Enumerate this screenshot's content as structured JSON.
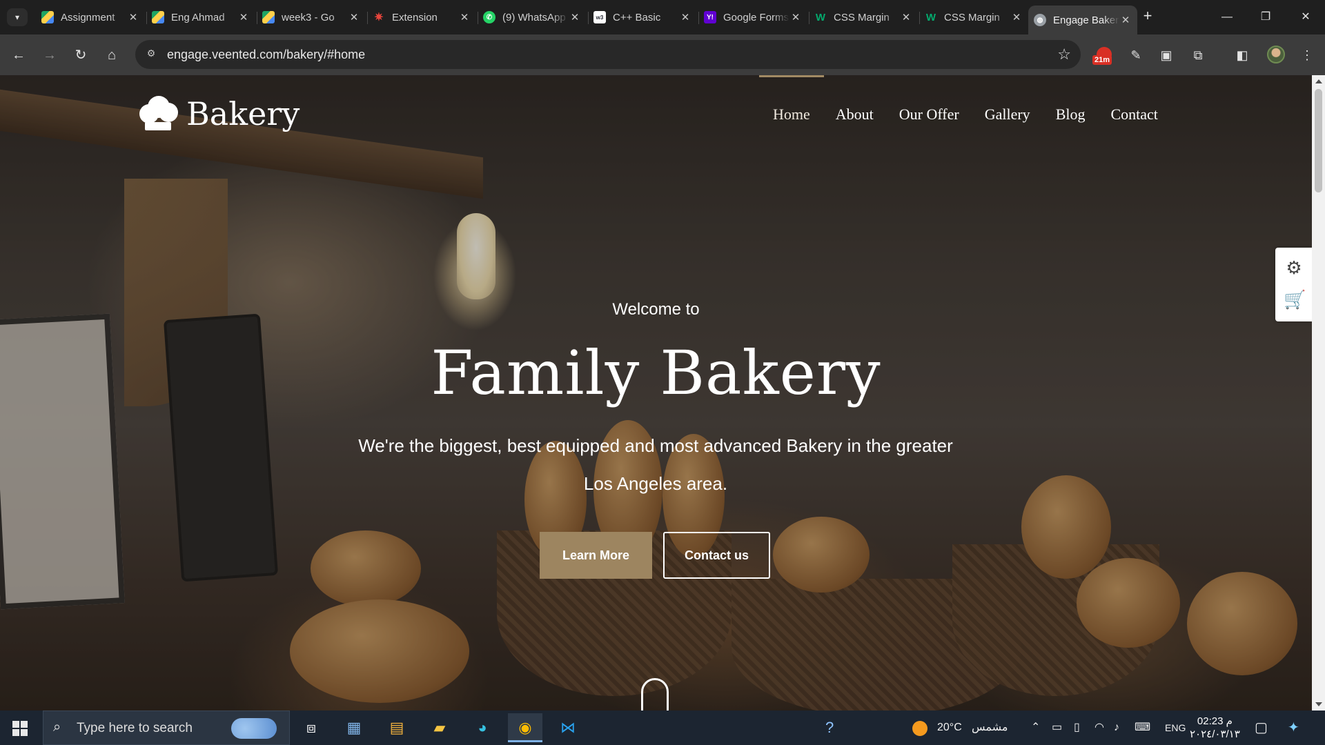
{
  "browser": {
    "tabs": [
      {
        "title": "Assignment",
        "favicon": "drive-icon",
        "color": "#1fa463"
      },
      {
        "title": "Eng Ahmad",
        "favicon": "drive-icon",
        "color": "#1fa463"
      },
      {
        "title": "week3 - Go",
        "favicon": "drive-icon",
        "color": "#1fa463"
      },
      {
        "title": "Extension",
        "favicon": "spark-icon",
        "color": "#e8453c"
      },
      {
        "title": "(9) WhatsApp",
        "favicon": "whatsapp-icon",
        "color": "#25d366"
      },
      {
        "title": "C++ Basic",
        "favicon": "w3schools-icon",
        "color": "#ffffff"
      },
      {
        "title": "Google Forms",
        "favicon": "yahoo-icon",
        "color": "#6001d2"
      },
      {
        "title": "CSS Margin",
        "favicon": "w3-green-icon",
        "color": "#04aa6d"
      },
      {
        "title": "CSS Margin",
        "favicon": "w3-green-icon",
        "color": "#04aa6d"
      },
      {
        "title": "Engage Bakery",
        "favicon": "globe-icon",
        "color": "#9aa0a6",
        "active": true
      }
    ],
    "url": "engage.veented.com/bakery/#home",
    "extension_badge": "21m"
  },
  "site": {
    "brand": "Bakery",
    "nav": [
      "Home",
      "About",
      "Our Offer",
      "Gallery",
      "Blog",
      "Contact"
    ],
    "active_nav": "Home",
    "accent": "#9d8560",
    "hero": {
      "pre_title": "Welcome to",
      "title": "Family Bakery",
      "text": "We're the biggest, best equipped and most advanced Bakery in the greater Los Angeles area.",
      "btn_primary": "Learn More",
      "btn_secondary": "Contact us"
    }
  },
  "taskbar": {
    "search_placeholder": "Type here to search",
    "weather_temp": "20°C",
    "weather_text": "مشمس",
    "language": "ENG",
    "time": "02:23 م",
    "date": "٢٠٢٤/٠٣/١٣"
  }
}
